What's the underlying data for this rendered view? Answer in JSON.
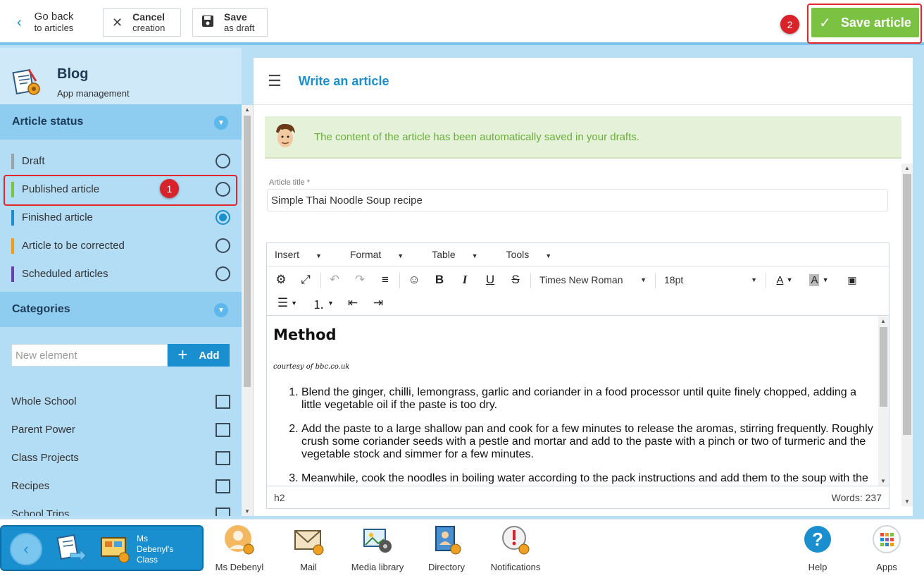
{
  "topbar": {
    "back": {
      "line1": "Go back",
      "line2": "to articles"
    },
    "cancel": {
      "line1": "Cancel",
      "line2": "creation"
    },
    "save_draft": {
      "line1": "Save",
      "line2": "as draft"
    },
    "save_article": "Save article"
  },
  "badges": {
    "one": "1",
    "two": "2"
  },
  "sidebar": {
    "title": "Blog",
    "subtitle": "App management",
    "status_section": "Article status",
    "statuses": [
      {
        "label": "Draft",
        "color": "#9aa3aa",
        "selected": false
      },
      {
        "label": "Published article",
        "color": "#7cc242",
        "selected": false
      },
      {
        "label": "Finished article",
        "color": "#1a8fd0",
        "selected": true
      },
      {
        "label": "Article to be corrected",
        "color": "#f39c12",
        "selected": false
      },
      {
        "label": "Scheduled articles",
        "color": "#6a3fb0",
        "selected": false
      }
    ],
    "categories_section": "Categories",
    "new_element_placeholder": "New element",
    "add_label": "Add",
    "categories": [
      {
        "label": "Whole School"
      },
      {
        "label": "Parent Power"
      },
      {
        "label": "Class Projects"
      },
      {
        "label": "Recipes"
      },
      {
        "label": "School Trips"
      }
    ]
  },
  "main": {
    "title": "Write an article",
    "notice": "The content of the article has been automatically saved in your drafts.",
    "article_title_label": "Article title *",
    "article_title_value": "Simple Thai Noodle Soup recipe",
    "editor": {
      "menus": [
        "Insert",
        "Format",
        "Table",
        "Tools"
      ],
      "font_family": "Times New Roman",
      "font_size": "18pt",
      "heading": "Method",
      "courtesy": "courtesy of bbc.co.uk",
      "steps": [
        "Blend the ginger, chilli, lemongrass, garlic and coriander in a food processor until quite finely chopped, adding a little vegetable oil if the paste is too dry.",
        "Add the paste to a large shallow pan and cook for a few minutes to release the aromas, stirring frequently. Roughly crush some coriander seeds with a pestle and mortar and add to the paste with a pinch or two of turmeric and the vegetable stock and simmer for a few minutes.",
        "Meanwhile, cook the noodles in boiling water according to the pack instructions and add them to the soup with the spring onions."
      ],
      "status_path": "h2",
      "word_count": "Words: 237"
    }
  },
  "dock": {
    "class_name": "Ms Debenyl's Class",
    "items": [
      {
        "label": "Ms Debenyl"
      },
      {
        "label": "Mail"
      },
      {
        "label": "Media library"
      },
      {
        "label": "Directory"
      },
      {
        "label": "Notifications"
      },
      {
        "label": "Help"
      },
      {
        "label": "Apps"
      }
    ]
  }
}
